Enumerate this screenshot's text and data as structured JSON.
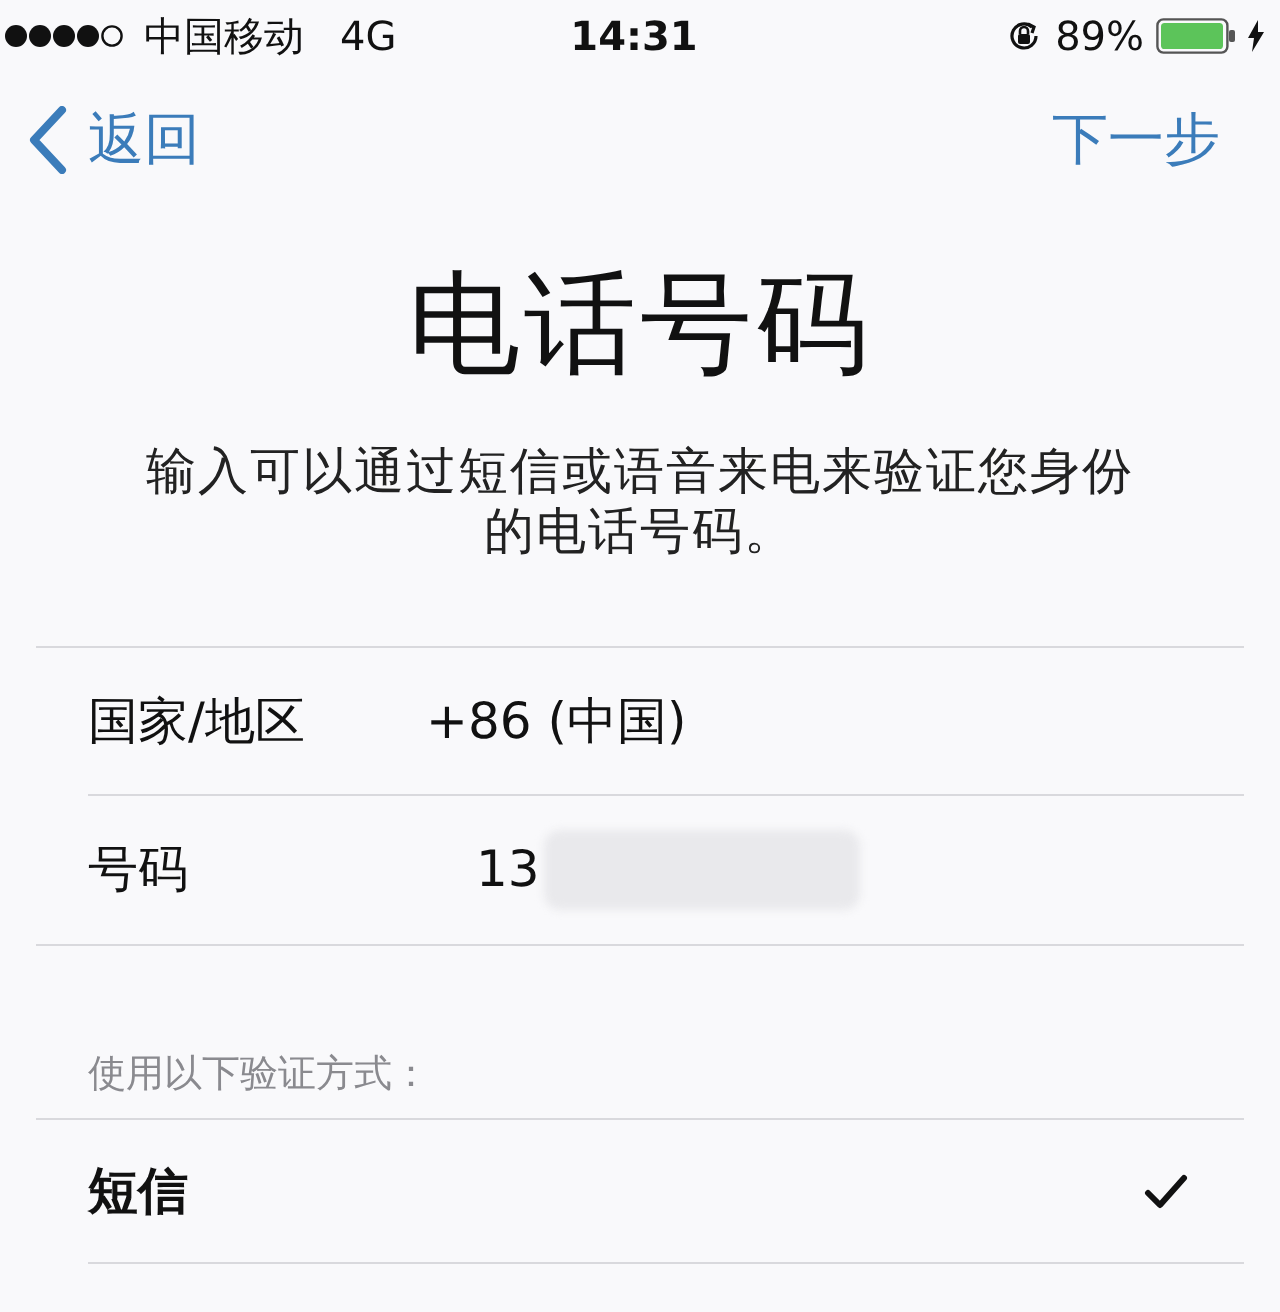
{
  "status_bar": {
    "carrier": "中国移动",
    "network": "4G",
    "time": "14:31",
    "battery": "89%"
  },
  "nav": {
    "back": "返回",
    "next": "下一步"
  },
  "title": "电话号码",
  "description": "输入可以通过短信或语音来电来验证您身份的电话号码。",
  "fields": [
    {
      "kind": "picker",
      "label": "国家/地区",
      "value": "+86 (中国)"
    },
    {
      "kind": "input",
      "label": "号码",
      "value": "13",
      "masked": true
    }
  ],
  "verification": {
    "header": "使用以下验证方式：",
    "methods": [
      {
        "label": "短信",
        "selected": true
      }
    ]
  }
}
